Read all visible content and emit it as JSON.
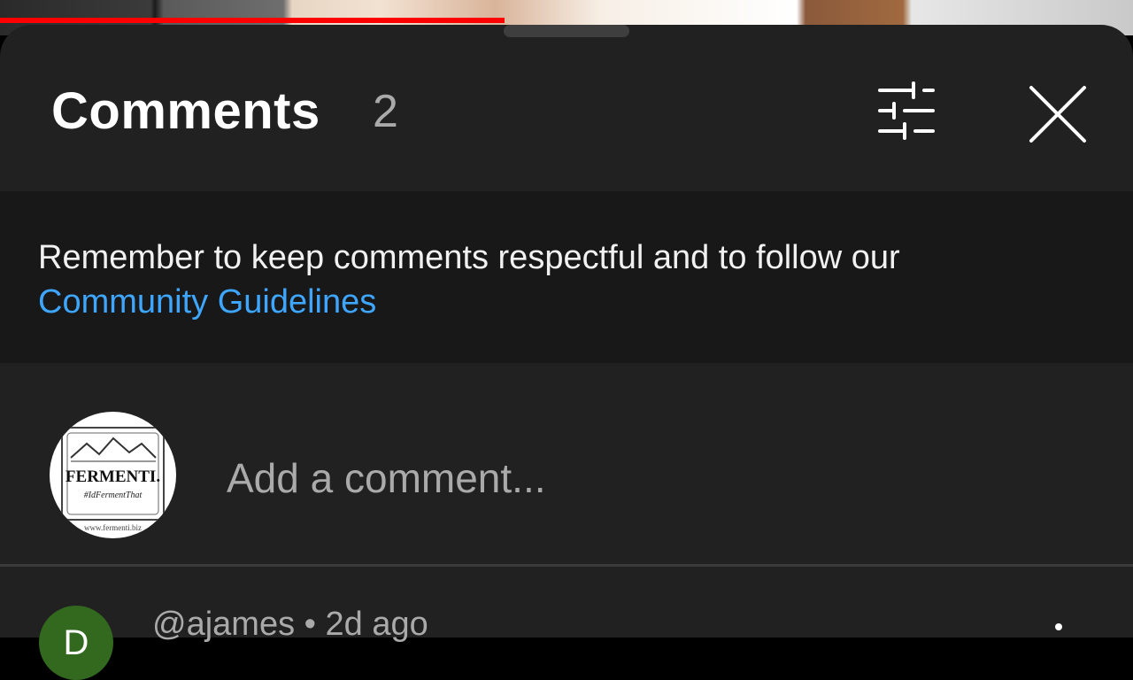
{
  "header": {
    "title": "Comments",
    "count": "2",
    "filter_icon": "filter-sliders-icon",
    "close_icon": "close-icon"
  },
  "notice": {
    "text_before_link": "Remember to keep comments respectful and to follow our ",
    "link_text": "Community Guidelines"
  },
  "composer": {
    "placeholder": "Add a comment...",
    "avatar_brand": "FERMENTI.",
    "avatar_tagline": "#IdFermentThat",
    "avatar_url_text": "www.fermenti.biz"
  },
  "comments": [
    {
      "avatar_letter": "D",
      "handle": "@ajames",
      "separator": "•",
      "age": "2d ago"
    }
  ],
  "colors": {
    "sheet_bg": "#212121",
    "notice_bg": "#181818",
    "link": "#3ea6ff",
    "progress": "#ff0000",
    "avatar_user": "#33691e"
  }
}
